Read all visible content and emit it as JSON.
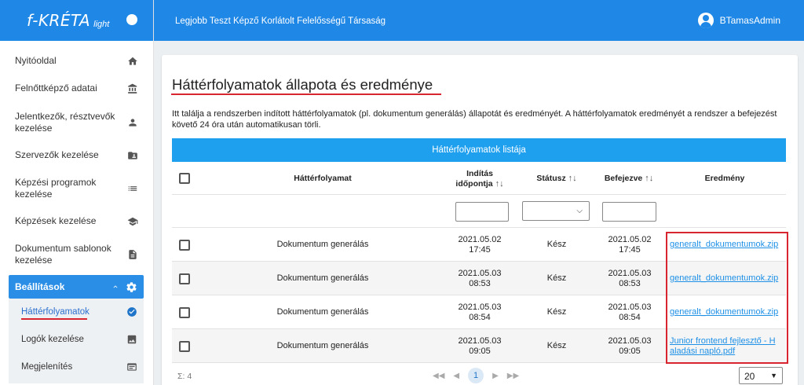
{
  "brand": {
    "logo": "f-KRÉTA",
    "logo_sub": "light"
  },
  "topbar": {
    "org": "Legjobb Teszt Képző Korlátolt Felelősségű Társaság",
    "user": "BTamasAdmin"
  },
  "sidebar": {
    "items": [
      {
        "label": "Nyitóoldal",
        "icon": "home-icon"
      },
      {
        "label": "Felnőttképző adatai",
        "icon": "institution-icon"
      },
      {
        "label": "Jelentkezők, résztvevők kezelése",
        "icon": "person-icon"
      },
      {
        "label": "Szervezők kezelése",
        "icon": "folder-user-icon"
      },
      {
        "label": "Képzési programok kezelése",
        "icon": "list-icon"
      },
      {
        "label": "Képzések kezelése",
        "icon": "graduation-cap-icon"
      },
      {
        "label": "Dokumentum sablonok kezelése",
        "icon": "document-icon"
      }
    ],
    "group": {
      "label": "Beállítások",
      "icon": "gear-icon"
    },
    "sub_items": [
      {
        "label": "Háttérfolyamatok",
        "icon": "check-circle-icon",
        "active": true
      },
      {
        "label": "Logók kezelése",
        "icon": "image-icon"
      },
      {
        "label": "Megjelenítés",
        "icon": "display-icon"
      }
    ]
  },
  "main": {
    "title": "Háttérfolyamatok állapota és eredménye",
    "description": "Itt találja a rendszerben indított háttérfolyamatok (pl. dokumentum generálás) állapotát és eredményét. A háttérfolyamatok eredményét a rendszer a befejezést követő 24 óra után automatikusan törli.",
    "table_title": "Háttérfolyamatok listája",
    "columns": {
      "process": "Háttérfolyamat",
      "start_line1": "Indítás",
      "start_line2": "időpontja",
      "status": "Státusz",
      "end": "Befejezve",
      "result": "Eredmény",
      "sort_glyph": "↑↓"
    },
    "rows": [
      {
        "process": "Dokumentum generálás",
        "start_date": "2021.05.02",
        "start_time": "17:45",
        "status": "Kész",
        "end_date": "2021.05.02",
        "end_time": "17:45",
        "result_line1": "generalt_dokumentumok.zip",
        "result_line2": ""
      },
      {
        "process": "Dokumentum generálás",
        "start_date": "2021.05.03",
        "start_time": "08:53",
        "status": "Kész",
        "end_date": "2021.05.03",
        "end_time": "08:53",
        "result_line1": "generalt_dokumentumok.zip",
        "result_line2": ""
      },
      {
        "process": "Dokumentum generálás",
        "start_date": "2021.05.03",
        "start_time": "08:54",
        "status": "Kész",
        "end_date": "2021.05.03",
        "end_time": "08:54",
        "result_line1": "generalt_dokumentumok.zip",
        "result_line2": ""
      },
      {
        "process": "Dokumentum generálás",
        "start_date": "2021.05.03",
        "start_time": "09:05",
        "status": "Kész",
        "end_date": "2021.05.03",
        "end_time": "09:05",
        "result_line1": "Junior frontend fejlesztő - H",
        "result_line2": "aladási napló.pdf"
      }
    ],
    "footer": {
      "count": "Σ: 4",
      "first": "◀◀",
      "prev": "◀",
      "page": "1",
      "next": "▶",
      "last": "▶▶",
      "page_size": "20"
    }
  },
  "colors": {
    "primary": "#1f87e6",
    "table_header": "#1ea0ef",
    "link": "#1e90e6",
    "highlight": "#d8252f"
  }
}
